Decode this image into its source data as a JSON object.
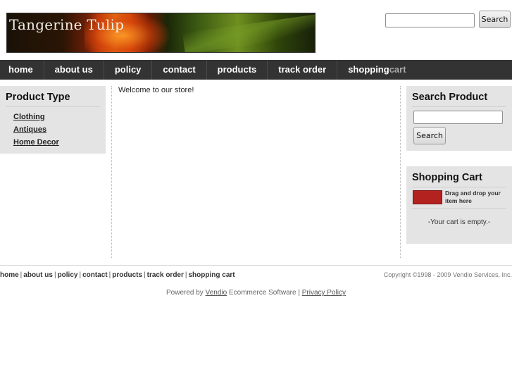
{
  "header": {
    "store_name": "Tangerine Tulip",
    "search_button": "Search"
  },
  "nav": {
    "items": [
      "home",
      "about us",
      "policy",
      "contact",
      "products",
      "track order"
    ],
    "cart_part1": "shopping",
    "cart_part2": "cart"
  },
  "left": {
    "heading": "Product Type",
    "categories": [
      "Clothing",
      "Antiques",
      "Home Decor"
    ]
  },
  "main": {
    "welcome": "Welcome to our store!"
  },
  "search_box": {
    "heading": "Search Product",
    "button": "Search"
  },
  "cart_box": {
    "heading": "Shopping Cart",
    "hint": "Drag and drop your item here",
    "empty": "-Your cart is empty.-",
    "icon_color": "#b3221f"
  },
  "footer": {
    "links": [
      "home",
      "about us",
      "policy",
      "contact",
      "products",
      "track order",
      "shopping cart"
    ],
    "separator": "|",
    "copyright": "Copyright ©1998 - 2009 Vendio Services, Inc.",
    "powered_prefix": "Powered by",
    "powered_link": "Vendio",
    "powered_middle": "Ecommerce Software",
    "powered_sep": "|",
    "privacy_link": "Privacy Policy"
  },
  "colors": {
    "nav_bg": "#333333",
    "panel_bg": "#e4e4e4"
  }
}
